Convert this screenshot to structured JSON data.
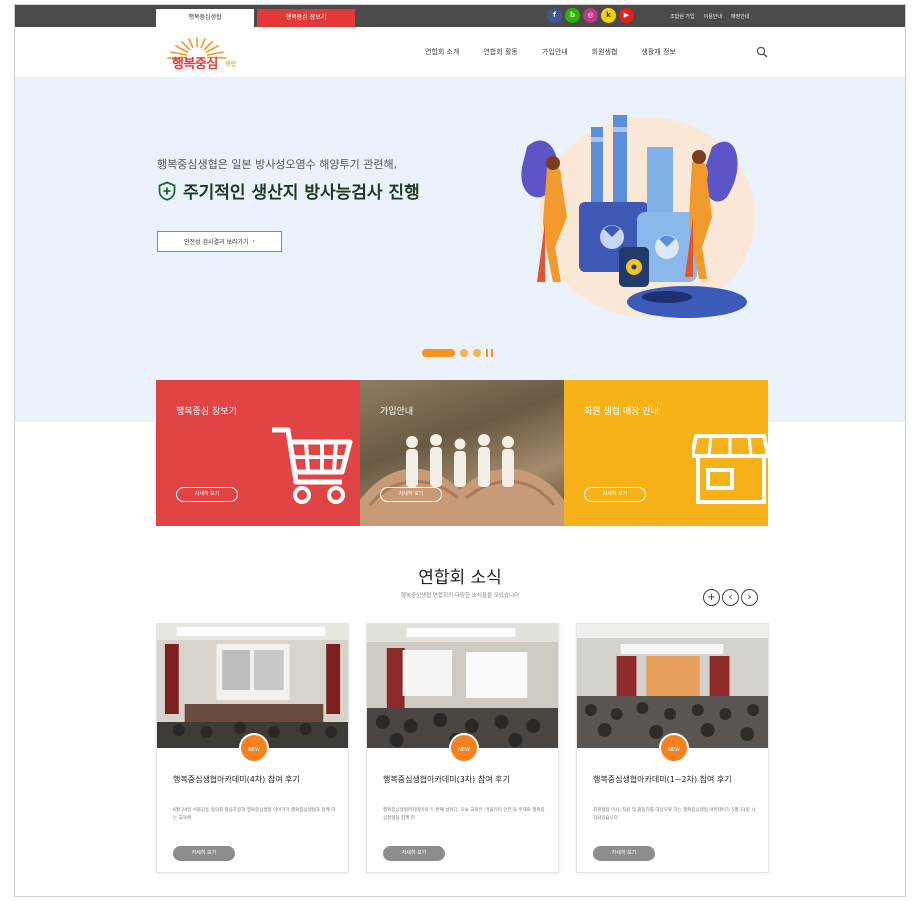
{
  "topbar": {
    "tab_main": "행복중심생협",
    "tab_shop": "행복중심 장보기",
    "social": [
      {
        "icon": "facebook-icon",
        "glyph": "f",
        "color": "#3b5998"
      },
      {
        "icon": "blog-icon",
        "glyph": "b",
        "color": "#2db400"
      },
      {
        "icon": "instagram-icon",
        "glyph": "◎",
        "color": "#c13584"
      },
      {
        "icon": "kakao-icon",
        "glyph": "k",
        "color": "#f7d600"
      },
      {
        "icon": "youtube-icon",
        "glyph": "▶",
        "color": "#e62117"
      }
    ],
    "links": [
      "조합원 가입",
      "이용안내",
      "매장안내"
    ]
  },
  "header": {
    "logo_text": "행복중심",
    "logo_sub": "생협",
    "nav": [
      "연합회 소개",
      "연합회 활동",
      "가입안내",
      "회원생협",
      "생활재 정보"
    ]
  },
  "hero": {
    "subtitle": "행복중심생협은 일본 방사성오염수 해양투기 관련해,",
    "title": "주기적인 생산지 방사능검사 진행",
    "button_label": "안전성 검사결과 보러가기",
    "button_arrow": "›"
  },
  "cards": [
    {
      "title": "행복중심 장보기",
      "button": "자세히 보기",
      "color": "#e04445"
    },
    {
      "title": "가입안내",
      "button": "자세히 보기"
    },
    {
      "title": "회원 생협 매장 안내",
      "button": "자세히 보기",
      "color": "#f8b219"
    }
  ],
  "news": {
    "title": "연합회 소식",
    "subtitle": "행복중심생협 연합회의 다양한 소식들을 모았습니다",
    "arrows": {
      "add": "+",
      "prev": "‹",
      "next": "›"
    },
    "items": [
      {
        "badge": "NEW",
        "title": "행복중심생협아카데미(4차) 참여 후기",
        "body": "6월 24일 서울공용 협의회 활동조정과 행복중심생협 이어가기 행복중심생협과 함께 하는 교육에",
        "button": "자세히 보기"
      },
      {
        "badge": "NEW",
        "title": "행복중심생협아카데미(3차) 참여 후기",
        "body": "행복중심생협아카데미의 두 번째 날이다. 오늘 교육은 '먹을거리 안전'을 주제로 행복중심생협을 함께 한",
        "button": "자세히 보기"
      },
      {
        "badge": "NEW",
        "title": "행복중심생협아카데미(1~2차) 참여 후기",
        "body": "회원생협 이사, 직원 및 활동가를 대상으로 하는 행복중심생협 아카데미가 5월 31일 시작되었습니다",
        "button": "자세히 보기"
      }
    ]
  }
}
